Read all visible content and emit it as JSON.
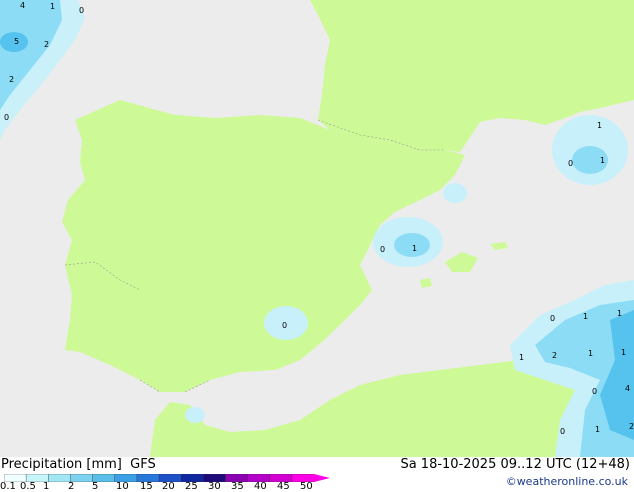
{
  "footer": {
    "title_left": "Precipitation [mm]  GFS",
    "title_right": "Sa 18-10-2025 09..12 UTC (12+48)",
    "credit": "©weatheronline.co.uk"
  },
  "legend": {
    "tick_labels": [
      "0.1",
      "0.5",
      "1",
      "2",
      "5",
      "10",
      "15",
      "20",
      "25",
      "30",
      "35",
      "40",
      "45",
      "50"
    ],
    "colors": [
      "#f0ffff",
      "#c8f5fa",
      "#a0e6f5",
      "#7dd2f0",
      "#5abeeb",
      "#3ca0e6",
      "#2878dc",
      "#1e50c8",
      "#0f28a0",
      "#1e0a78",
      "#8c00b4",
      "#b400c8",
      "#d200d2",
      "#ff00e6"
    ]
  },
  "map": {
    "colors": {
      "sea": "#ececec",
      "land": "#cdfa96",
      "precip_light": "#c8f0fa",
      "precip_mid": "#8cdcf5",
      "precip_high": "#55c3ee"
    },
    "value_labels": [
      "4",
      "1",
      "0",
      "5",
      "2",
      "2",
      "0",
      "1",
      "0",
      "1",
      "0",
      "1",
      "0",
      "0",
      "1",
      "1",
      "1",
      "2",
      "1",
      "1",
      "4",
      "0",
      "0",
      "1",
      "2"
    ]
  }
}
